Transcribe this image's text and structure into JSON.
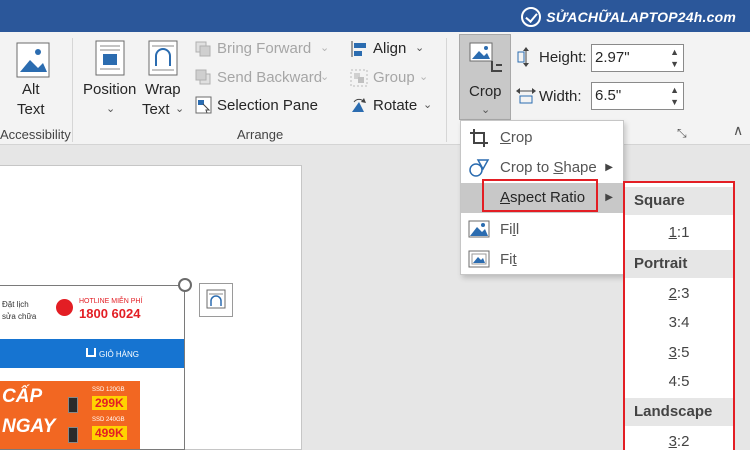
{
  "watermark": {
    "text": "SỬACHỮALAPTOP24h.com"
  },
  "ribbon": {
    "alt_text": {
      "line1": "Alt",
      "line2": "Text"
    },
    "accessibility_label": "Accessibility",
    "position_label": "Position",
    "wrap_text": {
      "line1": "Wrap",
      "line2": "Text"
    },
    "bring_forward": "Bring Forward",
    "send_backward": "Send Backward",
    "selection_pane": "Selection Pane",
    "align": "Align",
    "group": "Group",
    "rotate": "Rotate",
    "arrange_label": "Arrange",
    "crop_label": "Crop",
    "height_label": "Height:",
    "height_value": "2.97\"",
    "width_label": "Width:",
    "width_value": "6.5\""
  },
  "crop_menu": {
    "items": [
      {
        "label": "Crop",
        "accel": "C",
        "rest": "rop"
      },
      {
        "label": "Crop to Shape",
        "pre": "Crop to ",
        "accel": "S",
        "rest": "hape"
      },
      {
        "label": "Aspect Ratio",
        "accel": "A",
        "rest": "spect Ratio"
      },
      {
        "label": "Fill",
        "pre": "Fi",
        "accel": "l",
        "rest": "l"
      },
      {
        "label": "Fit",
        "pre": "Fi",
        "accel": "t",
        "rest": ""
      }
    ]
  },
  "aspect_submenu": {
    "square_header": "Square",
    "square": [
      {
        "accel": "1",
        "rest": ":1"
      }
    ],
    "portrait_header": "Portrait",
    "portrait": [
      {
        "accel": "2",
        "rest": ":3"
      },
      {
        "accel": "",
        "rest": "3:4"
      },
      {
        "accel": "3",
        "rest": ":5"
      },
      {
        "accel": "",
        "rest": "4:5"
      }
    ],
    "landscape_header": "Landscape",
    "landscape": [
      {
        "accel": "3",
        "rest": ":2"
      }
    ]
  },
  "picture": {
    "line1": "Đặt lịch",
    "line2": "sửa chữa",
    "hotline_label": "HOTLINE MIỄN PHÍ",
    "hotline_number": "1800 6024",
    "cart_label": "GIỎ HÀNG",
    "promo1": "CẤP",
    "promo2": "NGAY",
    "ssd1": "SSD 120GB",
    "price1": "299K",
    "ssd2": "SSD 240GB",
    "price2": "499K"
  },
  "colors": {
    "titlebar": "#2b579a",
    "highlight_border": "#e31e24",
    "menu_hover": "#c8c8c8"
  }
}
